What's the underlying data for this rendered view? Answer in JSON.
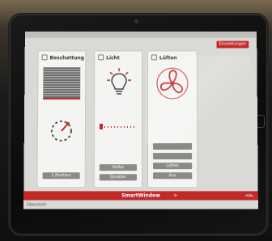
{
  "screen": {
    "top_button": "Einstellungen",
    "bottom_bar": {
      "title": "SmartWindow",
      "arrow": ">",
      "right_text": "Hilfe"
    },
    "footer": "Übersicht"
  },
  "panels": {
    "shading": {
      "title": "Beschattung",
      "button": "1 Position"
    },
    "light": {
      "title": "Licht",
      "buttons": [
        "Heller",
        "Dunkler"
      ]
    },
    "air": {
      "title": "Lüften",
      "buttons": [
        "",
        "",
        "Lüften",
        "Aus"
      ]
    }
  },
  "colors": {
    "accent": "#c22a2a",
    "panel": "#f4f4f2",
    "button": "#8a8a86"
  }
}
